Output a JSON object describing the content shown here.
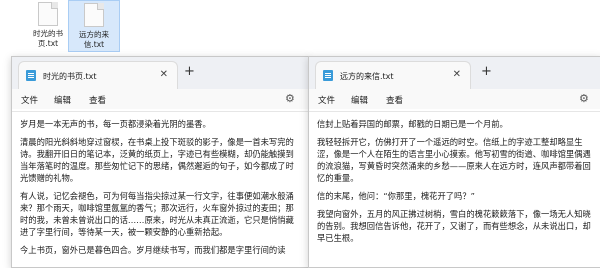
{
  "desktop": {
    "icons": [
      {
        "label_line1": "时光的书",
        "label_line2": "页.txt"
      },
      {
        "label_line1": "远方的来",
        "label_line2": "信.txt"
      }
    ]
  },
  "window1": {
    "tab_title": "时光的书页.txt",
    "menu": [
      "文件",
      "编辑",
      "查看"
    ],
    "paragraphs": [
      "岁月是一本无声的书，每一页都浸染着光阴的墨香。",
      "清晨的阳光斜斜地穿过窗棂，在书桌上投下斑驳的影子，像是一首未写完的诗。我翻开旧日的笔记本，泛黄的纸页上，字迹已有些模糊，却仍能触摸到当年落笔时的温度。那些匆忙记下的思绪，偶然邂逅的句子，如今都成了时光馈赠的礼物。",
      "有人说，记忆会褪色，可为何每当指尖掠过某一行文字，往事便如潮水般涌来？那个雨天，咖啡馆里氤氲的香气；那次远行，火车窗外掠过的麦田；那时的我，未曾未曾说出口的话……原来，时光从未真正流逝，它只是悄悄藏进了字里行间，等待某一天，被一颗安静的心重新拾起。",
      "今上书页，窗外已是暮色四合。岁月继续书写，而我们都是字里行间的读"
    ]
  },
  "window2": {
    "tab_title": "远方的来信.txt",
    "menu": [
      "文件",
      "编辑",
      "查看"
    ],
    "paragraphs": [
      "信封上贴着异国的邮票，邮戳的日期已是一个月前。",
      "我轻轻拆开它，仿佛打开了一个遥远的时空。信纸上的字迹工整却略显生涩，像是一个人在陌生的语言里小心摸索。他写初雪的街道、咖啡馆里偶遇的流浪猫，写黄昏时突然涌来的乡愁——原来人在远方时，连风声都带着回忆的重量。",
      "信的末尾，他问：“你那里，槐花开了吗？”",
      "我望向窗外，五月的风正拂过树梢，雪白的槐花簌簌落下，像一场无人知晓的告别。我想回信告诉他，花开了，又谢了，而有些想念，从未说出口，却早已生根。"
    ]
  }
}
